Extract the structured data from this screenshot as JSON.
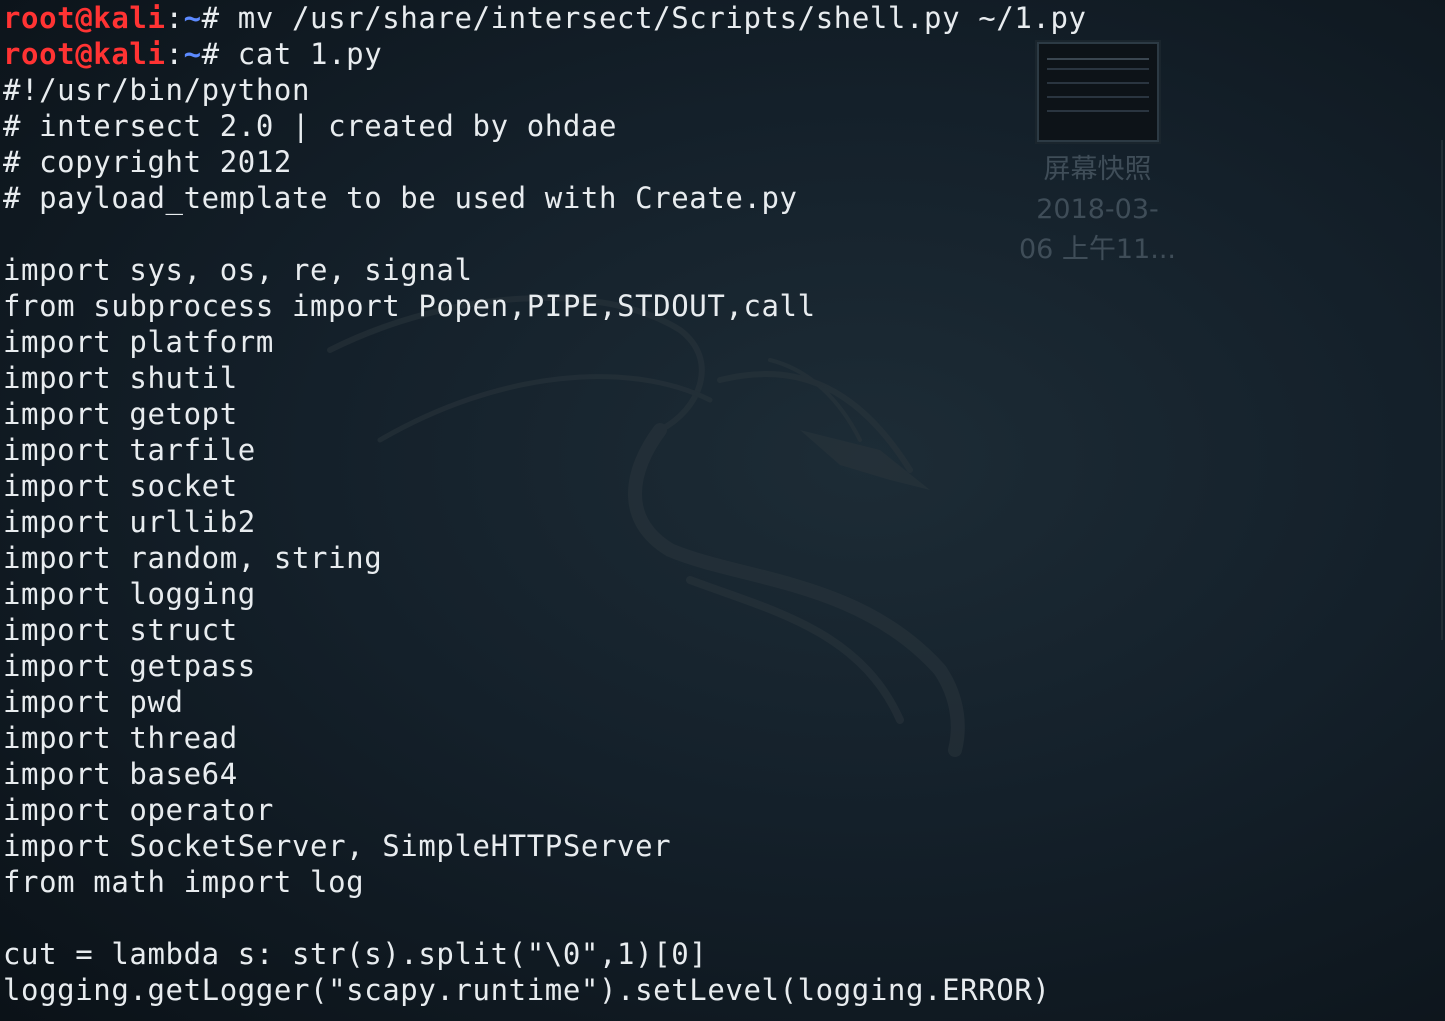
{
  "prompt": {
    "user_host": "root@kali",
    "separator": ":",
    "path": "~",
    "symbol": "#"
  },
  "commands": [
    " mv /usr/share/intersect/Scripts/shell.py ~/1.py",
    " cat 1.py"
  ],
  "output_lines": [
    "#!/usr/bin/python",
    "# intersect 2.0 | created by ohdae",
    "# copyright 2012",
    "# payload_template to be used with Create.py",
    "",
    "import sys, os, re, signal",
    "from subprocess import Popen,PIPE,STDOUT,call",
    "import platform",
    "import shutil",
    "import getopt",
    "import tarfile",
    "import socket",
    "import urllib2",
    "import random, string",
    "import logging",
    "import struct",
    "import getpass",
    "import pwd",
    "import thread",
    "import base64",
    "import operator",
    "import SocketServer, SimpleHTTPServer",
    "from math import log",
    "",
    "cut = lambda s: str(s).split(\"\\0\",1)[0]",
    "logging.getLogger(\"scapy.runtime\").setLevel(logging.ERROR)"
  ],
  "desktop_icon": {
    "label_line1": "屏幕快照",
    "label_line2": "2018-03-",
    "label_line3": "06 上午11..."
  },
  "colors": {
    "prompt_user": "#ff3333",
    "prompt_path": "#5c8aff",
    "text": "#e8ecef",
    "background": "#14202a"
  }
}
